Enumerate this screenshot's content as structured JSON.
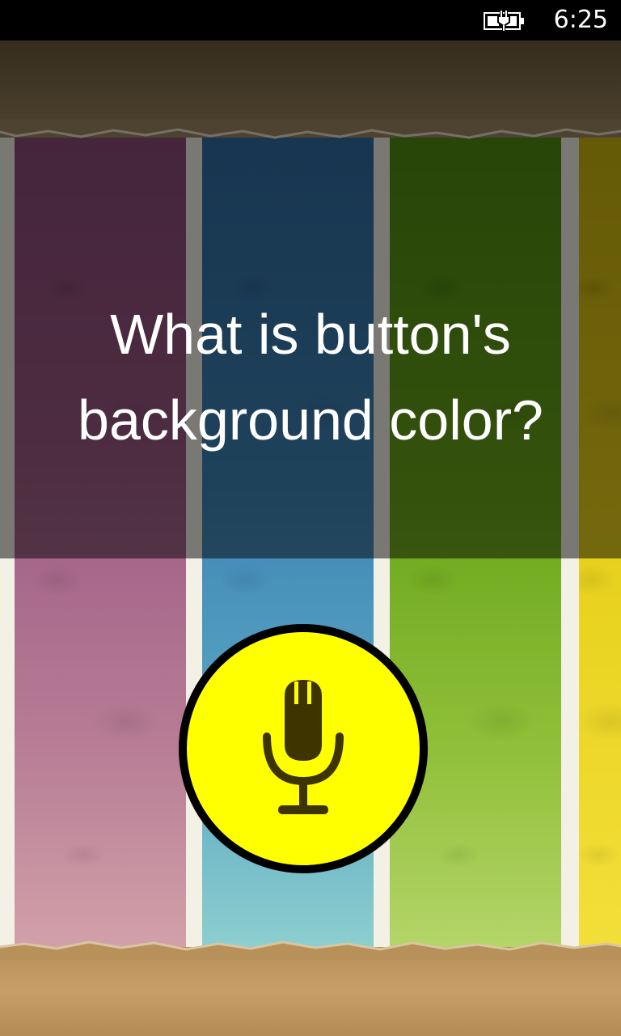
{
  "status_bar": {
    "time": "6:25",
    "battery_icon": "battery-charging-icon"
  },
  "question": {
    "line1": "What is button's",
    "line2": "background color?"
  },
  "mic_button": {
    "icon": "microphone-icon",
    "background_color": "#ffff00",
    "border_color": "#000000"
  },
  "stripes": {
    "colors": [
      "purple",
      "blue",
      "green",
      "yellow"
    ]
  }
}
